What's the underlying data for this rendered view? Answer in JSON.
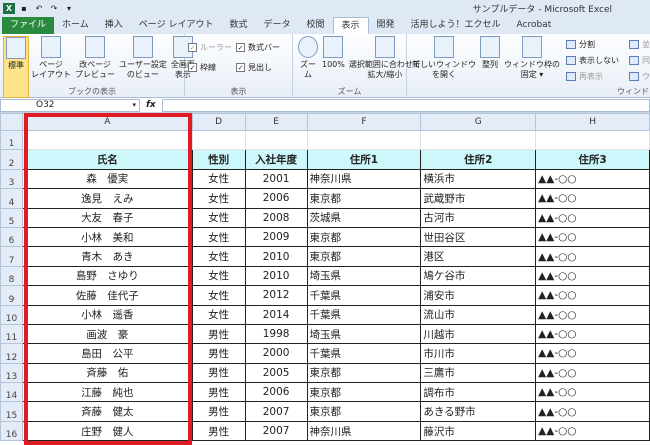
{
  "window": {
    "title": "サンプルデータ - Microsoft Excel"
  },
  "quick_access": [
    "save-icon",
    "undo-icon",
    "redo-icon",
    "customize-icon"
  ],
  "tabs": [
    "ファイル",
    "ホーム",
    "挿入",
    "ページ レイアウト",
    "数式",
    "データ",
    "校閲",
    "表示",
    "開発",
    "活用しよう！エクセル",
    "Acrobat"
  ],
  "active_tab": "表示",
  "ribbon": {
    "book_views": {
      "label": "ブックの表示",
      "buttons": [
        "標準",
        "ページ\nレイアウト",
        "改ページ\nプレビュー",
        "ユーザー設定\nのビュー",
        "全画面\n表示"
      ]
    },
    "show": {
      "label": "表示",
      "checks": [
        {
          "label": "ルーラー",
          "checked": true,
          "disabled": true
        },
        {
          "label": "数式バー",
          "checked": true
        },
        {
          "label": "枠線",
          "checked": true
        },
        {
          "label": "見出し",
          "checked": true
        }
      ]
    },
    "zoom": {
      "label": "ズーム",
      "buttons": [
        "ズーム",
        "100%",
        "選択範囲に合わせて\n拡大/縮小"
      ]
    },
    "window": {
      "label": "ウィンドウ",
      "buttons": [
        "新しいウィンドウ\nを開く",
        "整列",
        "ウィンドウ枠の\n固定 ▾"
      ],
      "small": [
        "分割",
        "表示しない",
        "再表示"
      ],
      "small2": [
        "並べて",
        "同時に",
        "ウィンド"
      ]
    }
  },
  "formula_bar": {
    "name_box": "O32",
    "fx": "fx",
    "value": ""
  },
  "columns": [
    "A",
    "D",
    "E",
    "F",
    "G",
    "H"
  ],
  "row_numbers": [
    1,
    2,
    3,
    4,
    5,
    6,
    7,
    8,
    9,
    10,
    11,
    12,
    13,
    14,
    15,
    16
  ],
  "header_row": [
    "氏名",
    "性別",
    "入社年度",
    "住所1",
    "住所2",
    "住所3"
  ],
  "rows": [
    [
      "森　優実",
      "女性",
      "2001",
      "神奈川県",
      "横浜市",
      "▲▲-○○"
    ],
    [
      "逸見　えみ",
      "女性",
      "2006",
      "東京都",
      "武蔵野市",
      "▲▲-○○"
    ],
    [
      "大友　春子",
      "女性",
      "2008",
      "茨城県",
      "古河市",
      "▲▲-○○"
    ],
    [
      "小林　美和",
      "女性",
      "2009",
      "東京都",
      "世田谷区",
      "▲▲-○○"
    ],
    [
      "青木　あき",
      "女性",
      "2010",
      "東京都",
      "港区",
      "▲▲-○○"
    ],
    [
      "島野　さゆり",
      "女性",
      "2010",
      "埼玉県",
      "鳩ケ谷市",
      "▲▲-○○"
    ],
    [
      "佐藤　佳代子",
      "女性",
      "2012",
      "千葉県",
      "浦安市",
      "▲▲-○○"
    ],
    [
      "小林　遥香",
      "女性",
      "2014",
      "千葉県",
      "流山市",
      "▲▲-○○"
    ],
    [
      "画波　豪",
      "男性",
      "1998",
      "埼玉県",
      "川越市",
      "▲▲-○○"
    ],
    [
      "島田　公平",
      "男性",
      "2000",
      "千葉県",
      "市川市",
      "▲▲-○○"
    ],
    [
      "斉藤　佑",
      "男性",
      "2005",
      "東京都",
      "三鷹市",
      "▲▲-○○"
    ],
    [
      "江藤　純也",
      "男性",
      "2006",
      "東京都",
      "調布市",
      "▲▲-○○"
    ],
    [
      "斉藤　健太",
      "男性",
      "2007",
      "東京都",
      "あきる野市",
      "▲▲-○○"
    ],
    [
      "庄野　健人",
      "男性",
      "2007",
      "神奈川県",
      "藤沢市",
      "▲▲-○○"
    ]
  ],
  "colors": {
    "header_fill": "#ccf7fb",
    "highlight_box": "#e01b24",
    "file_tab": "#2a8a3e"
  }
}
